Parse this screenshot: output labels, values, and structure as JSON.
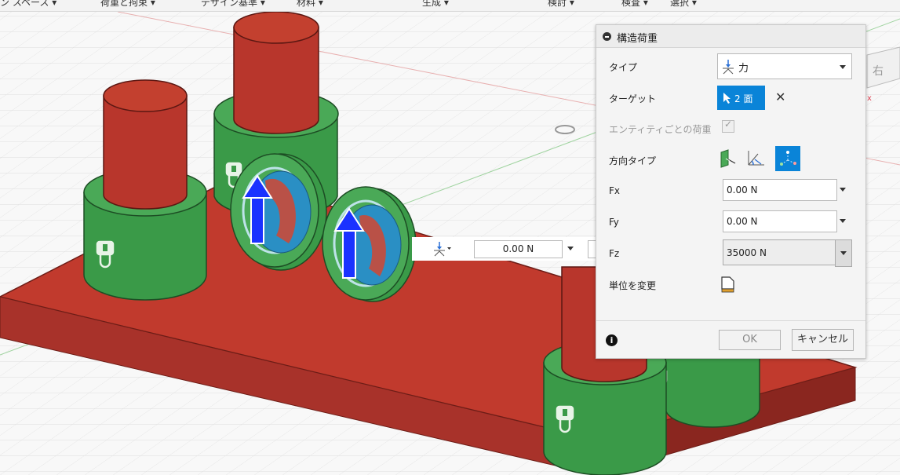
{
  "menubar": {
    "items": [
      "ン スペース ▾",
      "荷重と拘束 ▾",
      "デザイン基準 ▾",
      "材料 ▾",
      "生成 ▾",
      "検討 ▾",
      "検査 ▾",
      "選択 ▾"
    ]
  },
  "viewcube": {
    "face_label": "右"
  },
  "floating_input": {
    "value": "0.00 N"
  },
  "dialog": {
    "title": "構造荷重",
    "type_label": "タイプ",
    "type_value": "力",
    "target_label": "ターゲット",
    "target_value": "2 面",
    "per_entity_label": "エンティティごとの荷重",
    "per_entity_checked": true,
    "direction_label": "方向タイプ",
    "fx_label": "Fx",
    "fx_value": "0.00 N",
    "fy_label": "Fy",
    "fy_value": "0.00 N",
    "fz_label": "Fz",
    "fz_value": "35000 N",
    "units_label": "単位を変更",
    "ok_label": "OK",
    "cancel_label": "キャンセル"
  },
  "colors": {
    "plate_red": "#c0392b",
    "boss_green": "#3a9a48",
    "load_arrow_blue": "#1a32ff",
    "selected_face_blue": "#2a8fc4",
    "accent_blue": "#0a84d8"
  }
}
